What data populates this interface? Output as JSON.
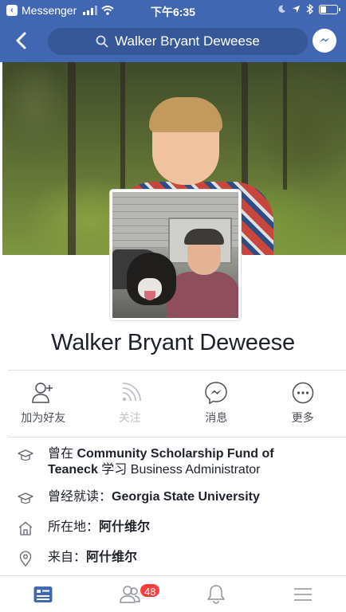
{
  "status_bar": {
    "app": "Messenger",
    "time": "下午6:35",
    "battery_level": 0.3
  },
  "nav": {
    "search_text": "Walker Bryant Deweese"
  },
  "profile": {
    "name": "Walker Bryant Deweese"
  },
  "actions": [
    {
      "label": "加为好友",
      "icon": "add-friend-icon",
      "enabled": true
    },
    {
      "label": "关注",
      "icon": "follow-rss-icon",
      "enabled": false
    },
    {
      "label": "消息",
      "icon": "messenger-icon",
      "enabled": true
    },
    {
      "label": "更多",
      "icon": "more-icon",
      "enabled": true
    }
  ],
  "about": {
    "work_prefix": "曾在 ",
    "work_org": "Community Scholarship Fund of Teaneck",
    "work_mid": " 学习 ",
    "work_role": "Business Administrator",
    "edu_prefix": "曾经就读：",
    "edu_school": "Georgia State University",
    "lives_prefix": "所在地：",
    "lives_place": "阿什维尔",
    "from_prefix": "来自：",
    "from_place": "阿什维尔"
  },
  "tab_bar": {
    "friend_requests_badge": "48"
  },
  "colors": {
    "brand": "#4267b2",
    "search_bg": "#365899",
    "badge": "#fa3e3e",
    "icon_gray": "#90949c"
  }
}
